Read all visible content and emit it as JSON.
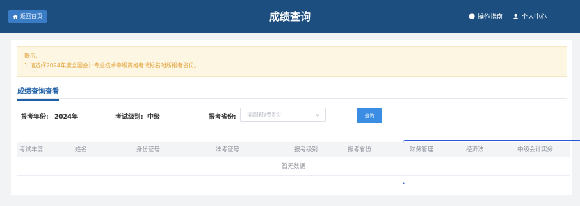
{
  "header": {
    "back_label": "返回首页",
    "title": "成绩查询",
    "guide_label": "操作指南",
    "user_center_label": "个人中心"
  },
  "notice": {
    "title": "提示:",
    "line1": "1.请选择2024年度全国会计专业技术中级资格考试报名时所报考省份。"
  },
  "tab": {
    "label": "成绩查询查看"
  },
  "filters": {
    "year_label": "报考年份:",
    "year_value": "2024年",
    "level_label": "考试级别:",
    "level_value": "中级",
    "province_label": "报考省份:",
    "province_placeholder": "请选择报考省份",
    "query_button": "查询"
  },
  "table": {
    "columns": [
      "考试年度",
      "姓名",
      "身份证号",
      "准考证号",
      "报考级别",
      "报考省份",
      "财务管理",
      "经济法",
      "中级会计实务"
    ],
    "empty_text": "暂无数据"
  },
  "colors": {
    "header_bg": "#1c4f80",
    "accent": "#1f5fa8",
    "button": "#3b8de3",
    "notice_text": "#e2a33a",
    "highlight_border": "#2b58d6"
  }
}
